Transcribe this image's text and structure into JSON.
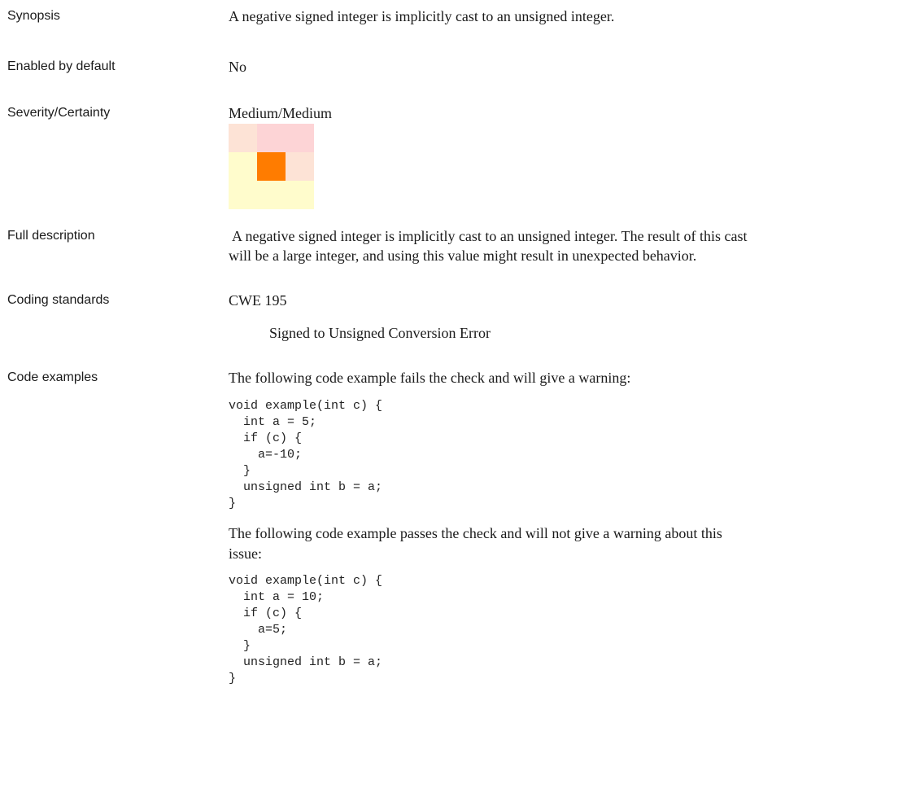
{
  "synopsis": {
    "label": "Synopsis",
    "text": "A negative signed integer is implicitly cast to an unsigned integer."
  },
  "enabled": {
    "label": "Enabled by default",
    "value": "No"
  },
  "severity": {
    "label": "Severity/Certainty",
    "value": "Medium/Medium",
    "matrix_colors": [
      [
        "#fde3d6",
        "#fdd4d6",
        "#fdd4d6"
      ],
      [
        "#fffccc",
        "#ff7c00",
        "#fde3d6"
      ],
      [
        "#fffccc",
        "#fffccc",
        "#fffccc"
      ]
    ]
  },
  "description": {
    "label": "Full description",
    "lines": [
      "A negative signed integer is implicitly cast to an unsigned integer. The result of this cast",
      "will be a large integer, and using this value might result in unexpected behavior."
    ]
  },
  "standards": {
    "label": "Coding standards",
    "standard": "CWE 195",
    "standard_desc": "Signed to Unsigned Conversion Error"
  },
  "examples": {
    "label": "Code examples",
    "fail_intro": "The following code example fails the check and will give a warning:",
    "fail_code": "void example(int c) {\n  int a = 5;\n  if (c) {\n    a=-10;\n  }\n  unsigned int b = a;\n}",
    "pass_intro_lines": [
      "The following code example passes the check and will not give a warning about this",
      "issue:"
    ],
    "pass_code": "void example(int c) {\n  int a = 10;\n  if (c) {\n    a=5;\n  }\n  unsigned int b = a;\n}"
  }
}
